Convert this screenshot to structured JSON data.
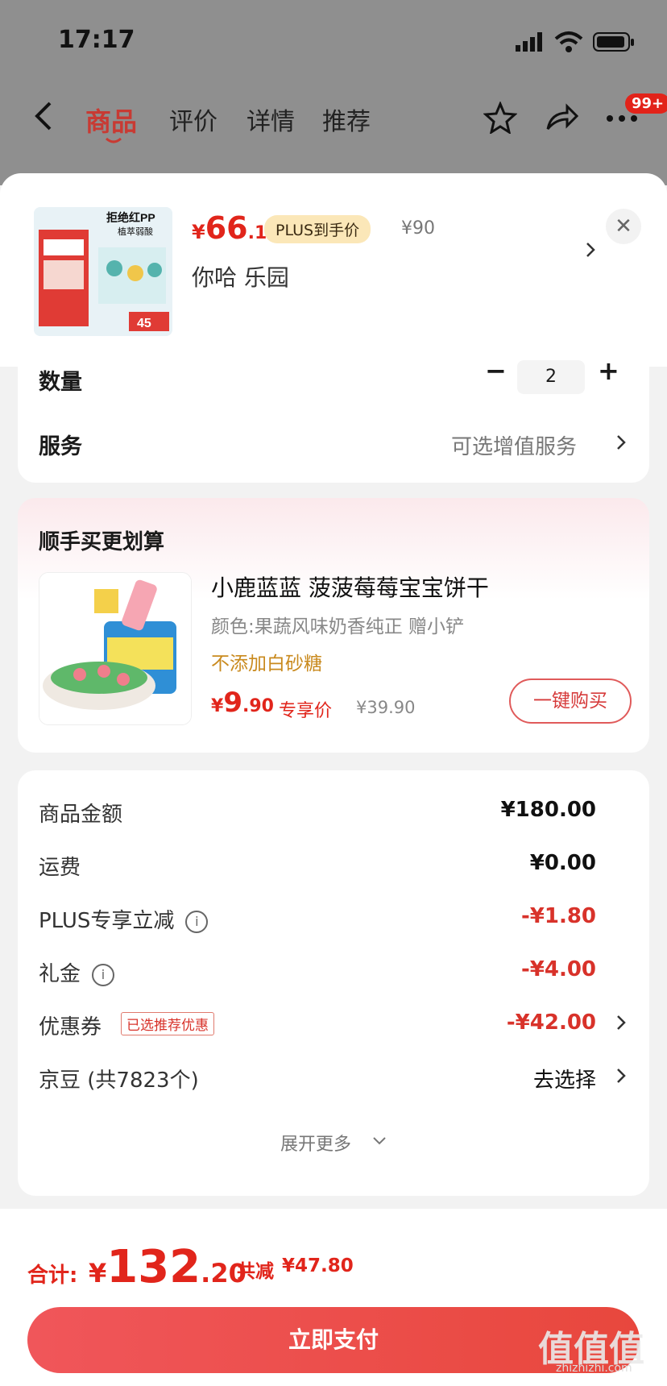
{
  "status_bar": {
    "time": "17:17"
  },
  "header": {
    "tabs": [
      "商品",
      "评价",
      "详情",
      "推荐"
    ],
    "active_tab": "商品",
    "badge": "99+"
  },
  "product_popup": {
    "price_yen": "¥",
    "price_int": "66",
    "price_dec": ".1",
    "plus_tag": "PLUS到手价",
    "original_price": "¥90",
    "spec": "你哈  乐园",
    "close": "✕",
    "thumb_title": "拒绝红PP",
    "thumb_sub": "植萃弱酸",
    "thumb_price": "45"
  },
  "order": {
    "quantity_label": "数量",
    "quantity": "2",
    "minus": "−",
    "plus": "+",
    "service_label": "服务",
    "service_value": "可选增值服务"
  },
  "addon": {
    "section_title": "顺手买更划算",
    "product_name": "小鹿蓝蓝 菠菠莓莓宝宝饼干",
    "product_spec": "颜色:果蔬风味奶香纯正 赠小铲",
    "product_tag": "不添加白砂糖",
    "price_yen": "¥",
    "price_int": "9",
    "price_dec": ".90",
    "price_label": "专享价",
    "original_price": "¥39.90",
    "buy_button": "一键购买"
  },
  "summary": {
    "goods_amount_label": "商品金额",
    "goods_amount": "¥180.00",
    "shipping_label": "运费",
    "shipping": "¥0.00",
    "plus_discount_label": "PLUS专享立减",
    "plus_discount": "-¥1.80",
    "gift_label": "礼金",
    "gift": "-¥4.00",
    "coupon_label": "优惠券",
    "coupon_tag": "已选推荐优惠",
    "coupon": "-¥42.00",
    "beans_label": "京豆 (共7823个)",
    "beans_value": "去选择",
    "expand": "展开更多"
  },
  "footer": {
    "total_label": "合计:",
    "total_yen": "¥",
    "total_int": "132",
    "total_dec": ".20",
    "saved_label": "共减",
    "saved_value": "¥47.80",
    "pay_button": "立即支付"
  },
  "watermark": {
    "big": "值值值",
    "small": "zhizhizhi.com"
  },
  "colors": {
    "accent": "#e1251b",
    "plus_tag_bg": "#fbe7b8"
  }
}
